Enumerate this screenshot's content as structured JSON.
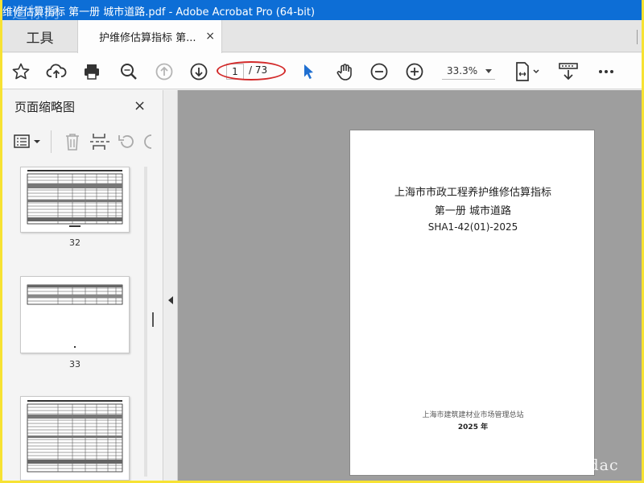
{
  "window": {
    "title": "维修估算指标 第一册 城市道路.pdf - Adobe Acrobat Pro (64-bit)",
    "watermark": "造标网"
  },
  "tabs": {
    "tools_label": "工具",
    "doc_label": "护维修估算指标 第...",
    "close_glyph": "×"
  },
  "toolbar": {
    "page_current": "1",
    "page_total": "/ 73",
    "zoom": "33.3%",
    "accent": "#d32a2a",
    "icons": [
      "star-icon",
      "cloud-upload-icon",
      "print-icon",
      "search-icon",
      "prev-page-icon",
      "next-page-icon",
      "select-cursor-icon",
      "hand-icon",
      "zoom-out-icon",
      "zoom-in-icon",
      "fit-page-icon",
      "scroll-mode-icon",
      "more-icon"
    ]
  },
  "left_panel": {
    "title": "页面缩略图",
    "close_glyph": "×",
    "thumbnails": [
      {
        "label": "32"
      },
      {
        "label": "33"
      },
      {
        "label": ""
      }
    ]
  },
  "document": {
    "line1": "上海市市政工程养护维修估算指标",
    "line2": "第一册  城市道路",
    "line3": "SHA1-42(01)-2025",
    "publisher": "上海市建筑建材业市场管理总站",
    "year": "2025 年"
  },
  "corner_watermark": "www.cndac"
}
